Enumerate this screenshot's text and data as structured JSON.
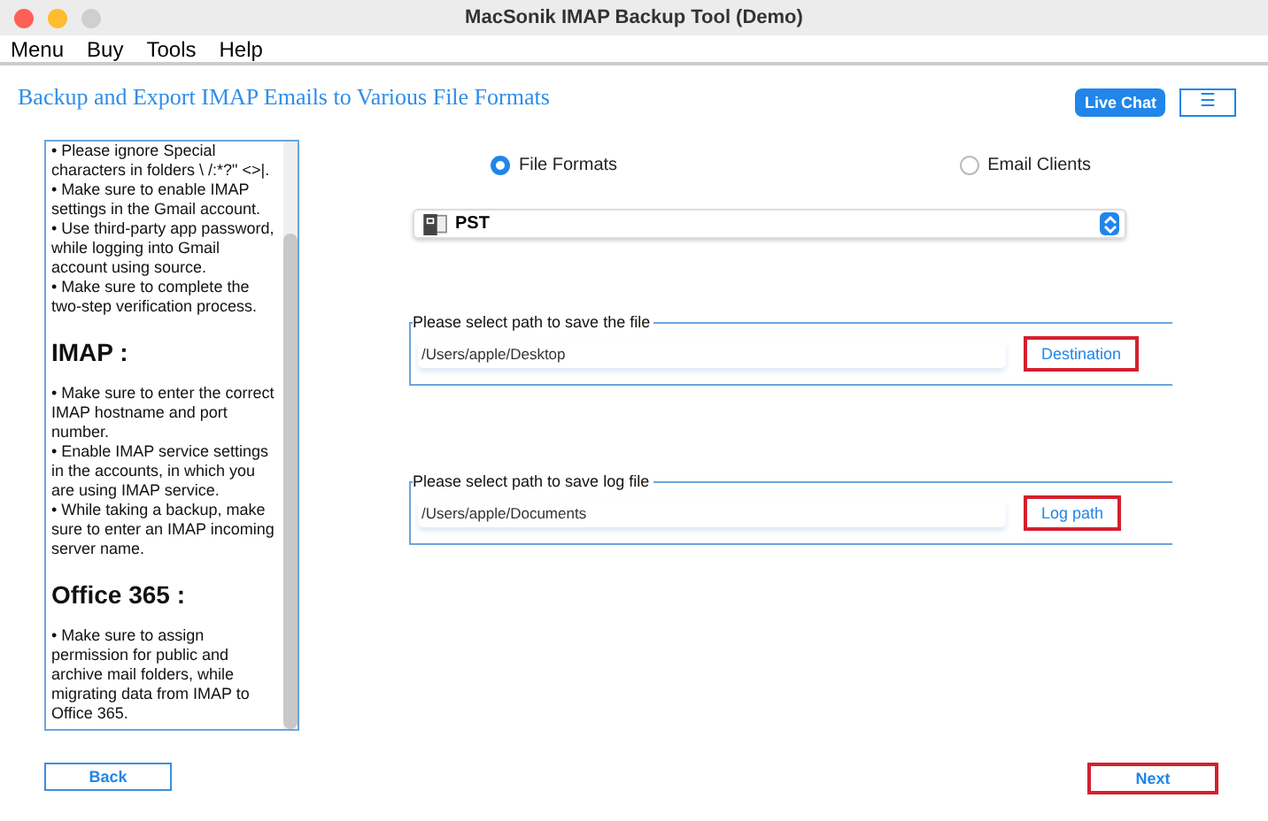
{
  "window": {
    "title": "MacSonik IMAP Backup Tool (Demo)"
  },
  "menu": [
    "Menu",
    "Buy",
    "Tools",
    "Help"
  ],
  "header": {
    "title": "Backup and Export IMAP Emails to Various File Formats",
    "chat_button": "Live Chat",
    "menu_button": "☰"
  },
  "help": [
    {
      "kind": "bullet",
      "text": "• Please ignore Special characters in folders  \\ /:*?\" <>|."
    },
    {
      "kind": "bullet",
      "text": "• Make sure to enable IMAP settings in the Gmail account."
    },
    {
      "kind": "bullet",
      "text": "• Use third-party app password, while logging into Gmail account using source."
    },
    {
      "kind": "bullet",
      "text": "• Make sure to complete the two-step verification process."
    },
    {
      "kind": "heading",
      "text": "IMAP :"
    },
    {
      "kind": "bullet",
      "text": "• Make sure to enter the correct IMAP hostname and port number."
    },
    {
      "kind": "bullet",
      "text": "• Enable IMAP service settings in the accounts, in which you are using IMAP service."
    },
    {
      "kind": "bullet",
      "text": "• While taking a backup, make sure to enter an IMAP incoming server name."
    },
    {
      "kind": "heading",
      "text": "Office 365 :"
    },
    {
      "kind": "bullet",
      "text": "• Make sure to assign permission for public and archive mail folders, while migrating data from IMAP to Office 365."
    }
  ],
  "options": [
    {
      "label": "File Formats",
      "selected": true
    },
    {
      "label": "Email Clients",
      "selected": false
    }
  ],
  "format": {
    "value": "PST"
  },
  "paths": [
    {
      "legend": "Please select path to save the file",
      "value": "/Users/apple/Desktop",
      "button": "Destination",
      "highlighted": true
    },
    {
      "legend": "Please select path to save log file",
      "value": "/Users/apple/Documents",
      "button": "Log path",
      "highlighted": true
    }
  ],
  "buttons": [
    {
      "label": "Back",
      "highlighted": false
    },
    {
      "label": "Next",
      "highlighted": true
    }
  ]
}
